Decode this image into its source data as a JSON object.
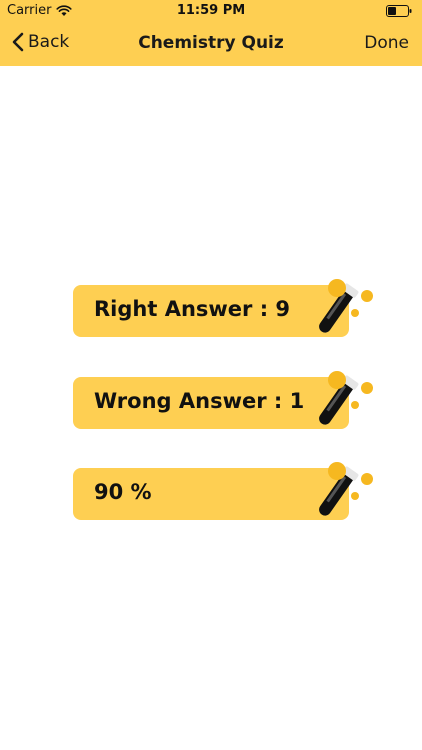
{
  "status_bar": {
    "carrier": "Carrier",
    "time": "11:59 PM"
  },
  "nav": {
    "back_label": "Back",
    "title": "Chemistry Quiz",
    "done_label": "Done"
  },
  "results": {
    "right": "Right Answer : 9",
    "wrong": "Wrong Answer : 1",
    "percent": "90 %"
  },
  "colors": {
    "accent": "#fecf52",
    "bubble": "#f6b820",
    "tube": "#111111",
    "text": "#111111"
  },
  "icons": {
    "result_card_icon": "test-tube-icon",
    "back_icon": "chevron-left-icon",
    "wifi_icon": "wifi-icon",
    "battery_icon": "battery-icon"
  }
}
